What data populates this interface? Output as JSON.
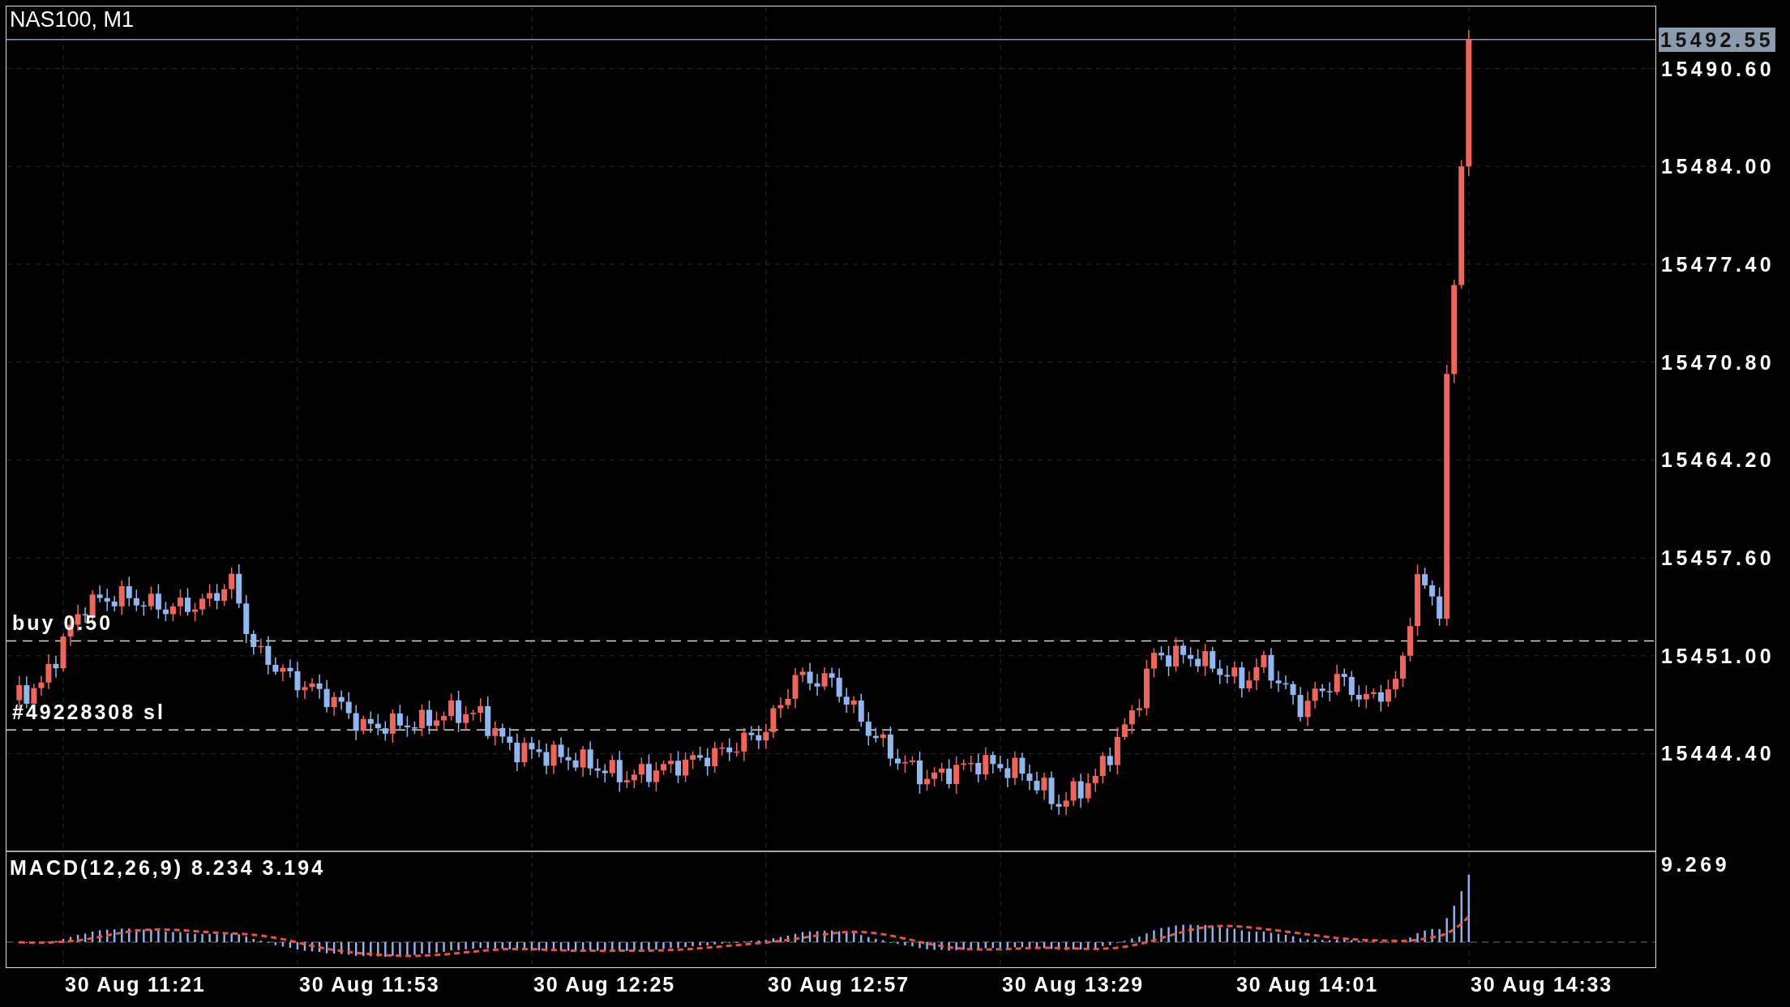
{
  "chart": {
    "title": "NAS100, M1",
    "price_axis": {
      "current_price": "15492.55",
      "ticks": [
        "15490.60",
        "15484.00",
        "15477.40",
        "15470.80",
        "15464.20",
        "15457.60",
        "15451.00",
        "15444.40"
      ]
    },
    "orders": [
      {
        "kind": "buy",
        "label": "buy 0.50"
      },
      {
        "kind": "stop_loss",
        "label": "#49228308 sl"
      }
    ],
    "indicator": {
      "label": "MACD(12,26,9) 8.234 3.194",
      "max_label": "9.269"
    },
    "time_axis": [
      "30 Aug 11:21",
      "30 Aug 11:53",
      "30 Aug 12:25",
      "30 Aug 12:57",
      "30 Aug 13:29",
      "30 Aug 14:01",
      "30 Aug 14:33"
    ]
  }
}
